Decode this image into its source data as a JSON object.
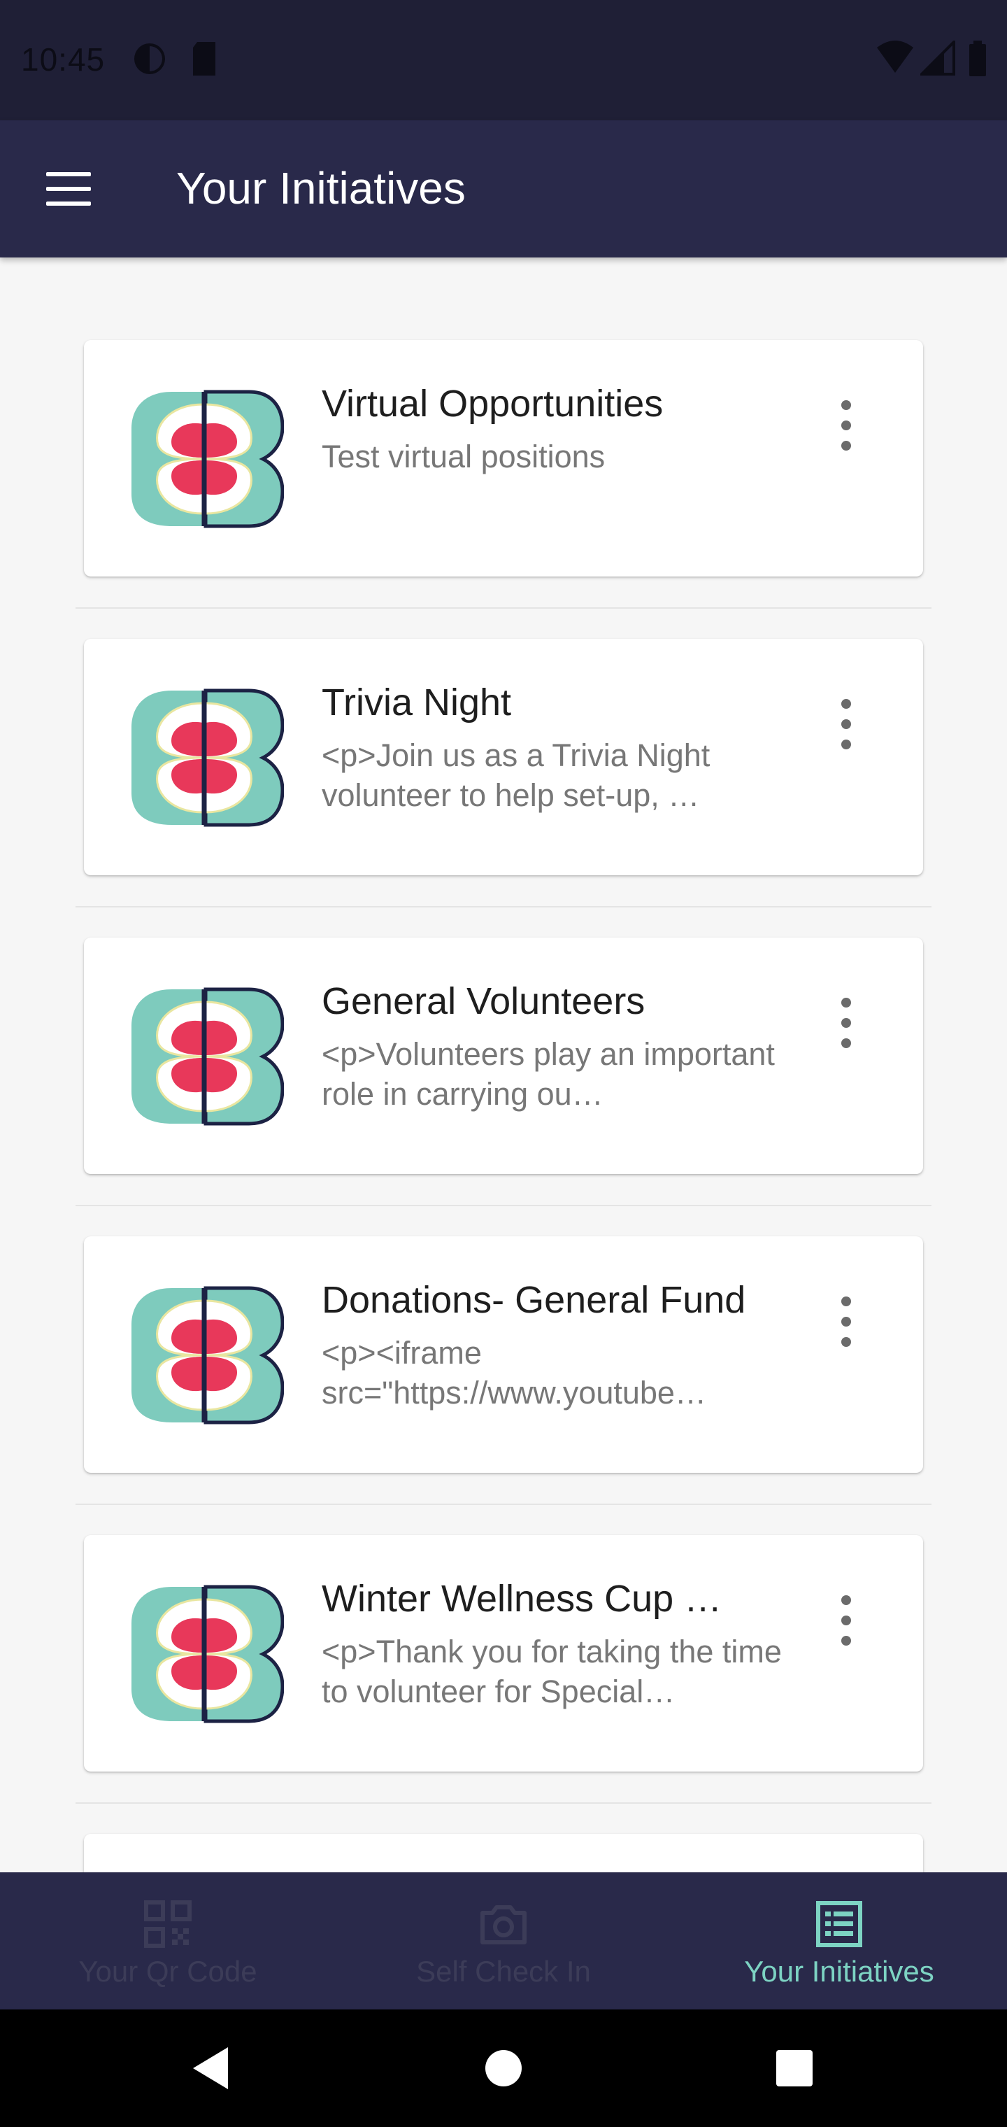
{
  "status_bar": {
    "time": "10:45"
  },
  "app_bar": {
    "title": "Your Initiatives"
  },
  "initiatives": [
    {
      "title": "Virtual Opportunities",
      "description": "Test virtual positions"
    },
    {
      "title": "Trivia Night",
      "description": "<p>Join us as a Trivia Night volunteer to help set-up, …"
    },
    {
      "title": "General Volunteers",
      "description": "<p>Volunteers play an important role in carrying ou…"
    },
    {
      "title": "Donations- General Fund",
      "description": "<p><iframe src=\"https://www.youtube…"
    },
    {
      "title": "Winter Wellness Cup …",
      "description": "<p>Thank you for taking the time to volunteer for Special…"
    }
  ],
  "bottom_nav": {
    "items": [
      {
        "label": "Your Qr Code",
        "icon": "qr-code-icon"
      },
      {
        "label": "Self Check In",
        "icon": "camera-icon"
      },
      {
        "label": "Your Initiatives",
        "icon": "list-icon"
      }
    ],
    "active_index": 2
  },
  "colors": {
    "app_bar": "#29294a",
    "status_bar": "#1f1f36",
    "accent": "#7dd3c3",
    "logo_teal": "#7ecbbd",
    "logo_red": "#e8385a",
    "logo_navy": "#1c2244"
  }
}
